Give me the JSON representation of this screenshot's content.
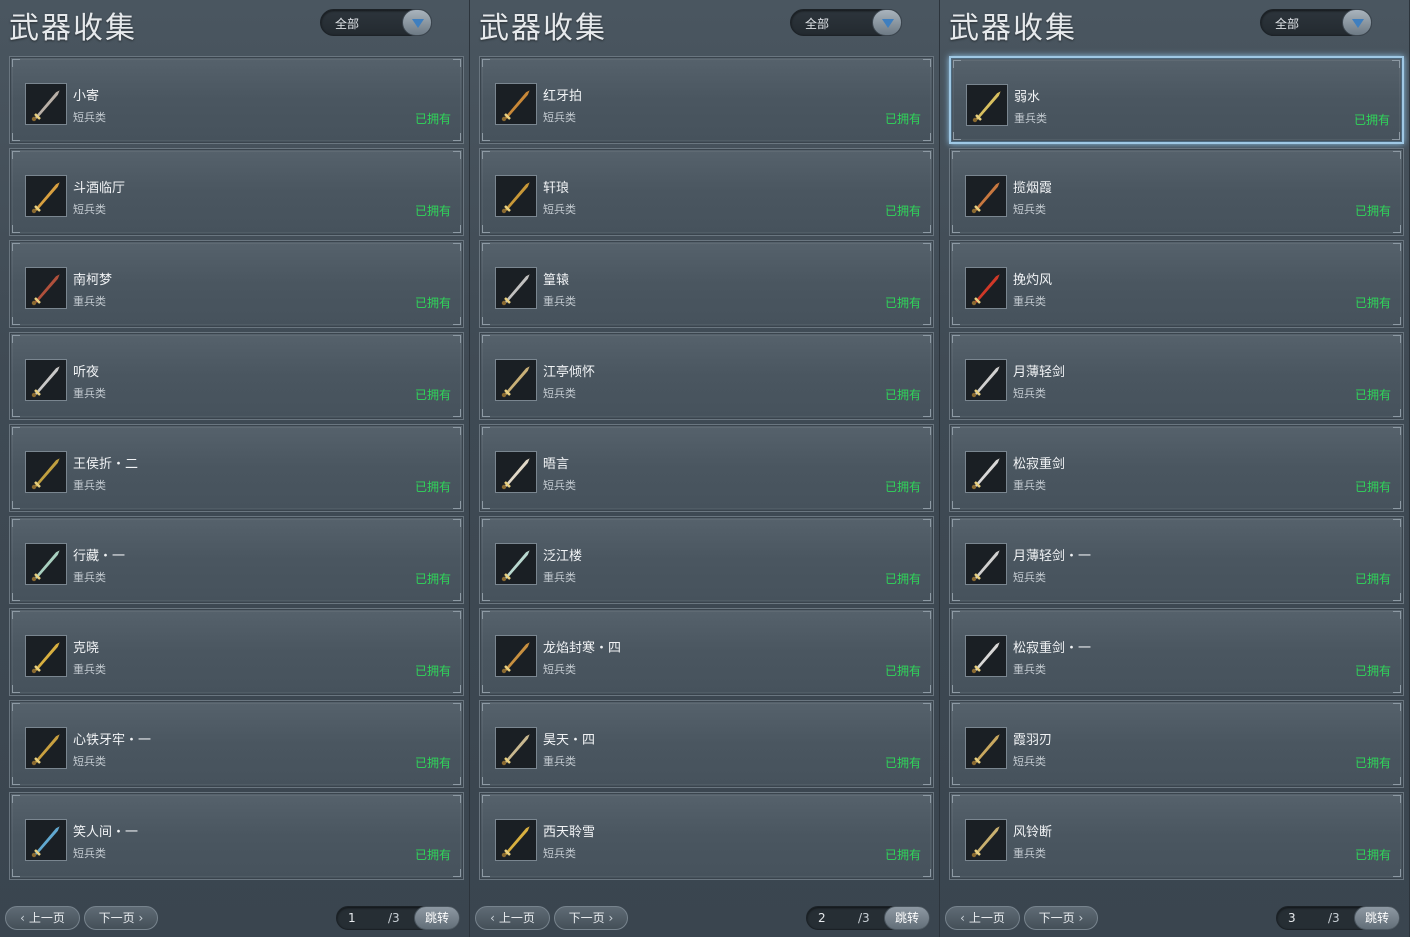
{
  "accent_colors": {
    "owned": "#2fd659",
    "selected_border": "#9fc8e4",
    "filter_arrow": "#3f7fbf"
  },
  "panels": [
    {
      "title": "武器收集",
      "filter": {
        "value": "全部",
        "icon": "chevron-down-icon"
      },
      "items": [
        {
          "name": "小寄",
          "type": "短兵类",
          "status": "已拥有",
          "icon": "dagger-icon",
          "color": "#b8b0a8"
        },
        {
          "name": "斗酒临厅",
          "type": "短兵类",
          "status": "已拥有",
          "icon": "golden-sword-icon",
          "color": "#d8a040"
        },
        {
          "name": "南柯梦",
          "type": "重兵类",
          "status": "已拥有",
          "icon": "hammer-icon",
          "color": "#b0503c"
        },
        {
          "name": "听夜",
          "type": "重兵类",
          "status": "已拥有",
          "icon": "blade-icon",
          "color": "#c8c8c8"
        },
        {
          "name": "王侯折・二",
          "type": "重兵类",
          "status": "已拥有",
          "icon": "dark-blade-icon",
          "color": "#c0a040"
        },
        {
          "name": "行藏・一",
          "type": "重兵类",
          "status": "已拥有",
          "icon": "jade-blade-icon",
          "color": "#a8d0c0"
        },
        {
          "name": "克晓",
          "type": "重兵类",
          "status": "已拥有",
          "icon": "gold-blade-icon",
          "color": "#d8b040"
        },
        {
          "name": "心铁牙牢・一",
          "type": "短兵类",
          "status": "已拥有",
          "icon": "staff-icon",
          "color": "#c8a040"
        },
        {
          "name": "笑人间・一",
          "type": "短兵类",
          "status": "已拥有",
          "icon": "spear-icon",
          "color": "#60a8d0"
        }
      ],
      "pager": {
        "prev": "上一页",
        "next": "下一页",
        "page": "1",
        "total": "/3",
        "jump": "跳转"
      }
    },
    {
      "title": "武器收集",
      "filter": {
        "value": "全部",
        "icon": "chevron-down-icon"
      },
      "items": [
        {
          "name": "红牙拍",
          "type": "短兵类",
          "status": "已拥有",
          "icon": "red-dagger-icon",
          "color": "#c88838"
        },
        {
          "name": "轩琅",
          "type": "短兵类",
          "status": "已拥有",
          "icon": "ornate-sword-icon",
          "color": "#c89838"
        },
        {
          "name": "篁辕",
          "type": "重兵类",
          "status": "已拥有",
          "icon": "axe-icon",
          "color": "#c0c0c0"
        },
        {
          "name": "江亭倾怀",
          "type": "短兵类",
          "status": "已拥有",
          "icon": "short-sword-icon",
          "color": "#c8b078"
        },
        {
          "name": "晤言",
          "type": "短兵类",
          "status": "已拥有",
          "icon": "wing-sword-icon",
          "color": "#e0d8c8"
        },
        {
          "name": "泛江楼",
          "type": "重兵类",
          "status": "已拥有",
          "icon": "silver-blade-icon",
          "color": "#b8d8d0"
        },
        {
          "name": "龙焰封寒・四",
          "type": "短兵类",
          "status": "已拥有",
          "icon": "dragon-sword-icon",
          "color": "#c89040"
        },
        {
          "name": "昊天・四",
          "type": "重兵类",
          "status": "已拥有",
          "icon": "heavy-blade-icon",
          "color": "#c8b890"
        },
        {
          "name": "西天聆雪",
          "type": "短兵类",
          "status": "已拥有",
          "icon": "trident-icon",
          "color": "#d8b040"
        }
      ],
      "pager": {
        "prev": "上一页",
        "next": "下一页",
        "page": "2",
        "total": "/3",
        "jump": "跳转"
      }
    },
    {
      "title": "武器收集",
      "filter": {
        "value": "全部",
        "icon": "chevron-down-icon"
      },
      "items": [
        {
          "name": "弱水",
          "type": "重兵类",
          "status": "已拥有",
          "icon": "gold-spear-icon",
          "color": "#d8c060",
          "selected": true
        },
        {
          "name": "揽烟霞",
          "type": "短兵类",
          "status": "已拥有",
          "icon": "bronze-sword-icon",
          "color": "#c87840"
        },
        {
          "name": "挽灼风",
          "type": "重兵类",
          "status": "已拥有",
          "icon": "fire-blade-icon",
          "color": "#d03828"
        },
        {
          "name": "月薄轻剑",
          "type": "短兵类",
          "status": "已拥有",
          "icon": "light-sword-icon",
          "color": "#d0d0d0"
        },
        {
          "name": "松寂重剑",
          "type": "重兵类",
          "status": "已拥有",
          "icon": "great-sword-icon",
          "color": "#d8d8d8"
        },
        {
          "name": "月薄轻剑・一",
          "type": "短兵类",
          "status": "已拥有",
          "icon": "light-sword-icon",
          "color": "#d0d0d0"
        },
        {
          "name": "松寂重剑・一",
          "type": "重兵类",
          "status": "已拥有",
          "icon": "great-sword-icon",
          "color": "#d8d8d8"
        },
        {
          "name": "霞羽刃",
          "type": "短兵类",
          "status": "已拥有",
          "icon": "feather-blade-icon",
          "color": "#c8a860"
        },
        {
          "name": "风铃断",
          "type": "重兵类",
          "status": "已拥有",
          "icon": "broad-blade-icon",
          "color": "#c8b070"
        }
      ],
      "pager": {
        "prev": "上一页",
        "next": "下一页",
        "page": "3",
        "total": "/3",
        "jump": "跳转"
      }
    }
  ]
}
